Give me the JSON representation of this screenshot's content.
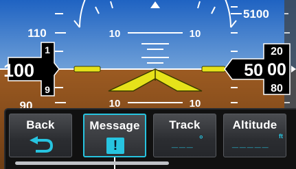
{
  "airspeed_tape": {
    "scale_labels": [
      "110",
      "90"
    ],
    "current_value": "100",
    "roller_upper_digit": "1",
    "roller_lower_digit": "9"
  },
  "altitude_tape": {
    "scale_labels": [
      "5100"
    ],
    "current_main": "50",
    "roller_upper": "20",
    "roller_center": "00",
    "roller_lower": "80"
  },
  "attitude": {
    "pitch_labels": [
      "10",
      "10",
      "10",
      "10"
    ]
  },
  "softkeys": {
    "back_label": "Back",
    "message_label": "Message",
    "message_glyph": "!",
    "track_label": "Track",
    "track_value": "___",
    "track_unit": "°",
    "altitude_label": "Altitude",
    "altitude_value": "_____",
    "altitude_unit": "ft"
  },
  "colors": {
    "sky": "#2b70c8",
    "ground": "#9a5a1f",
    "accent": "#27c4e0",
    "aircraft_symbol": "#e6e21a"
  }
}
